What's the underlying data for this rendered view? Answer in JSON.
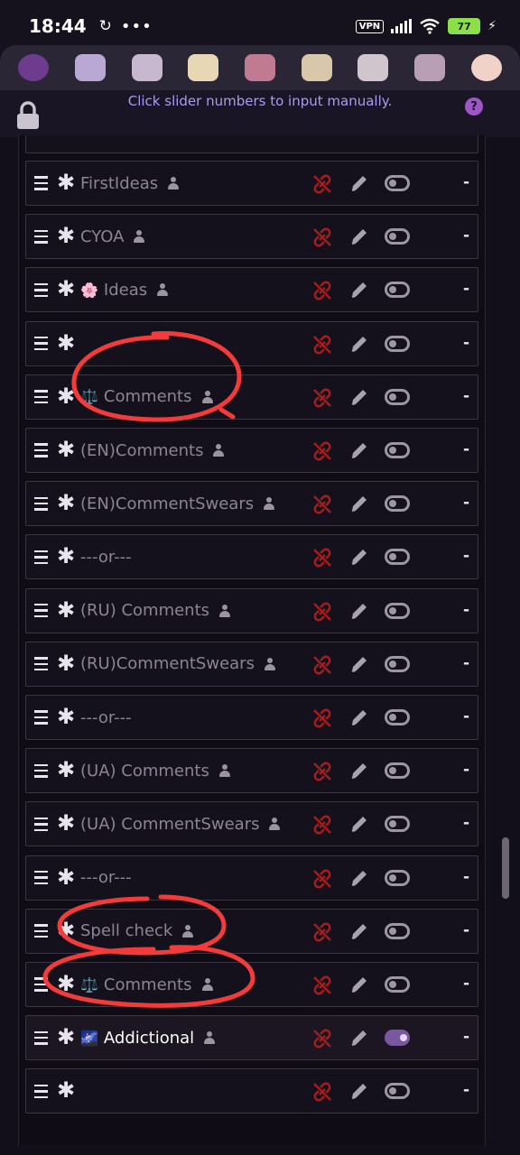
{
  "status": {
    "time": "18:44",
    "vpn": "VPN",
    "battery": "77"
  },
  "theme_bar": {
    "icons": [
      "planet-character-icon",
      "bunny-doll-icon",
      "seashell-icon",
      "cake-slice-icon",
      "round-cake-icon",
      "layer-cake-icon",
      "macaron-icon",
      "pastel-cake-icon",
      "cat-avatar-icon"
    ],
    "colors": [
      "#6e3b8e",
      "#b9a8d4",
      "#c8b8cf",
      "#e7d7b4",
      "#c07a92",
      "#d8c7a8",
      "#d0c5cd",
      "#b89fb6",
      "#f1d2c8"
    ]
  },
  "hint": "Click slider numbers to input manually.",
  "help_label": "?",
  "rows": [
    {
      "label": "FirstIdeas",
      "prefix": "",
      "person": true,
      "active": false,
      "toggle": false
    },
    {
      "label": "CYOA",
      "prefix": "",
      "person": true,
      "active": false,
      "toggle": false
    },
    {
      "label": "Ideas",
      "prefix": "🌸",
      "person": true,
      "active": false,
      "toggle": false
    },
    {
      "label": "",
      "prefix": "",
      "person": false,
      "active": false,
      "toggle": false
    },
    {
      "label": "Comments",
      "prefix": "⚖️",
      "person": true,
      "active": false,
      "toggle": false
    },
    {
      "label": "(EN)Comments",
      "prefix": "",
      "person": true,
      "active": false,
      "toggle": false
    },
    {
      "label": "(EN)CommentSwears",
      "prefix": "",
      "person": true,
      "active": false,
      "toggle": false
    },
    {
      "label": "---or---",
      "prefix": "",
      "person": false,
      "active": false,
      "toggle": false
    },
    {
      "label": "(RU) Comments",
      "prefix": "",
      "person": true,
      "active": false,
      "toggle": false
    },
    {
      "label": "(RU)CommentSwears",
      "prefix": "",
      "person": true,
      "active": false,
      "toggle": false
    },
    {
      "label": "---or---",
      "prefix": "",
      "person": false,
      "active": false,
      "toggle": false
    },
    {
      "label": "(UA) Comments",
      "prefix": "",
      "person": true,
      "active": false,
      "toggle": false
    },
    {
      "label": "(UA) CommentSwears",
      "prefix": "",
      "person": true,
      "active": false,
      "toggle": false
    },
    {
      "label": "---or---",
      "prefix": "",
      "person": false,
      "active": false,
      "toggle": false
    },
    {
      "label": "Spell check",
      "prefix": "",
      "person": true,
      "active": false,
      "toggle": false
    },
    {
      "label": "Comments",
      "prefix": "⚖️",
      "person": true,
      "active": false,
      "toggle": false
    },
    {
      "label": "Addictional",
      "prefix": "🌌",
      "person": true,
      "active": true,
      "toggle": true
    },
    {
      "label": "",
      "prefix": "",
      "person": false,
      "active": false,
      "toggle": false
    }
  ],
  "row_suffix": "-",
  "colors": {
    "accent": "#a99cf0",
    "link_red": "#a51d1d",
    "annotation_red": "#f23b3b"
  }
}
